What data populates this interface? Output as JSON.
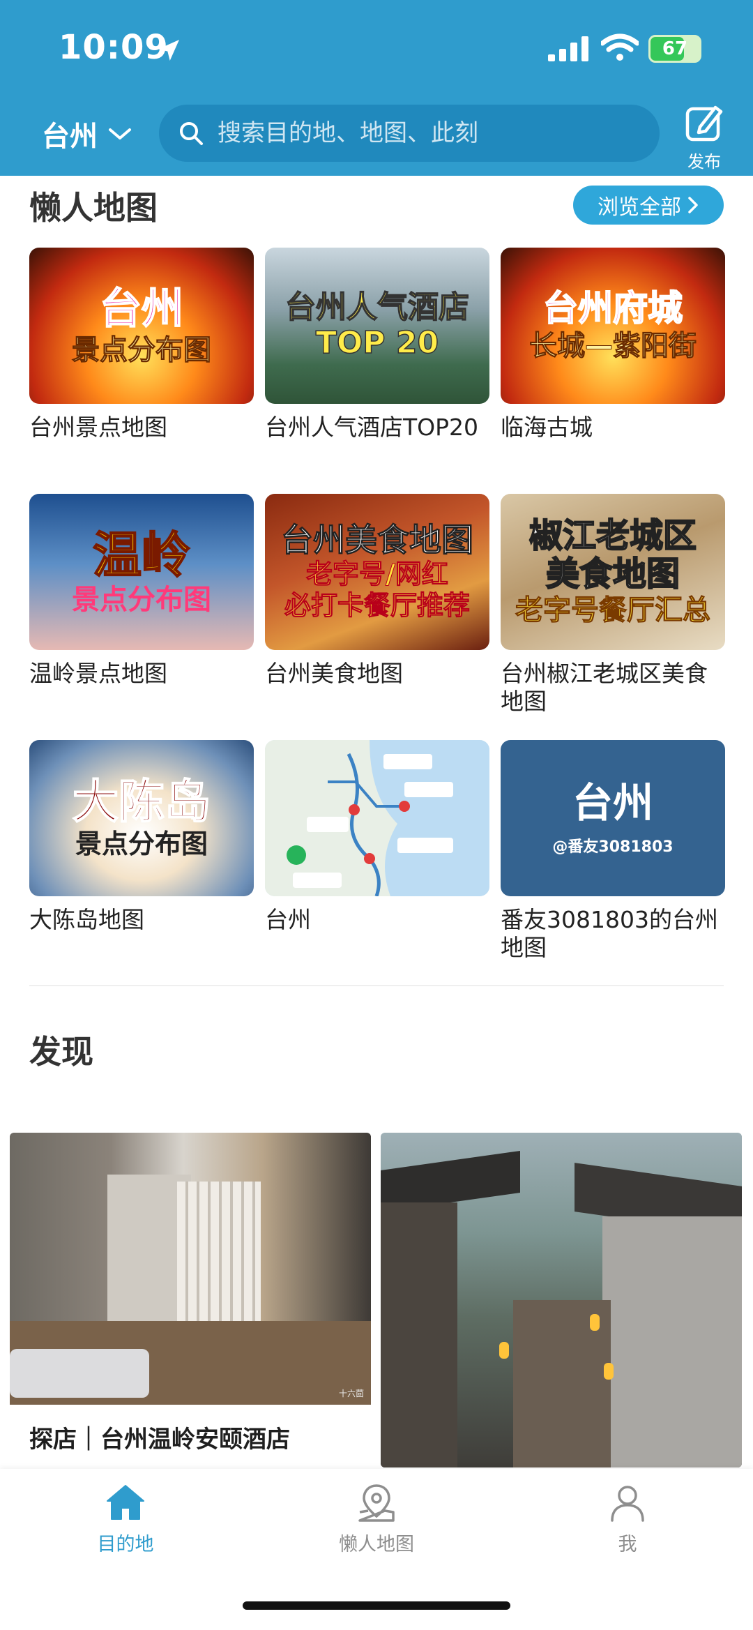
{
  "status": {
    "time": "10:09",
    "battery": "67"
  },
  "header": {
    "city": "台州",
    "search_placeholder": "搜索目的地、地图、此刻",
    "publish_label": "发布"
  },
  "lazy_maps": {
    "title": "懒人地图",
    "browse_all": "浏览全部",
    "items": [
      {
        "label": "台州景点地图",
        "thumb_text": [
          "台州",
          "景点分布图"
        ]
      },
      {
        "label": "台州人气酒店TOP20",
        "thumb_text": [
          "台州人气酒店",
          "TOP 20"
        ]
      },
      {
        "label": "临海古城",
        "thumb_text": [
          "台州府城",
          "长城—紫阳街"
        ]
      },
      {
        "label": "温岭景点地图",
        "thumb_text": [
          "温岭",
          "景点分布图"
        ]
      },
      {
        "label": "台州美食地图",
        "thumb_text": [
          "台州美食地图",
          "老字号/网红",
          "必打卡餐厅推荐"
        ]
      },
      {
        "label": "台州椒江老城区美食地图",
        "thumb_text": [
          "椒江老城区",
          "美食地图",
          "老字号餐厅汇总"
        ]
      },
      {
        "label": "大陈岛地图",
        "thumb_text": [
          "大陈岛",
          "景点分布图"
        ]
      },
      {
        "label": "台州",
        "thumb_text": []
      },
      {
        "label": "番友3081803的台州地图",
        "thumb_text": [
          "台州",
          "@番友3081803"
        ]
      }
    ]
  },
  "discover": {
    "title": "发现",
    "cards": [
      {
        "title": "探店｜台州温岭安颐酒店",
        "watermark": "十六茴"
      }
    ]
  },
  "tabbar": {
    "items": [
      {
        "label": "目的地",
        "icon": "home-icon",
        "active": true
      },
      {
        "label": "懒人地图",
        "icon": "map-pin-icon",
        "active": false
      },
      {
        "label": "我",
        "icon": "profile-icon",
        "active": false
      }
    ]
  },
  "colors": {
    "header_bg": "#2f9ccd",
    "accent": "#2fa7da",
    "active_tab": "#2f9ccd"
  }
}
